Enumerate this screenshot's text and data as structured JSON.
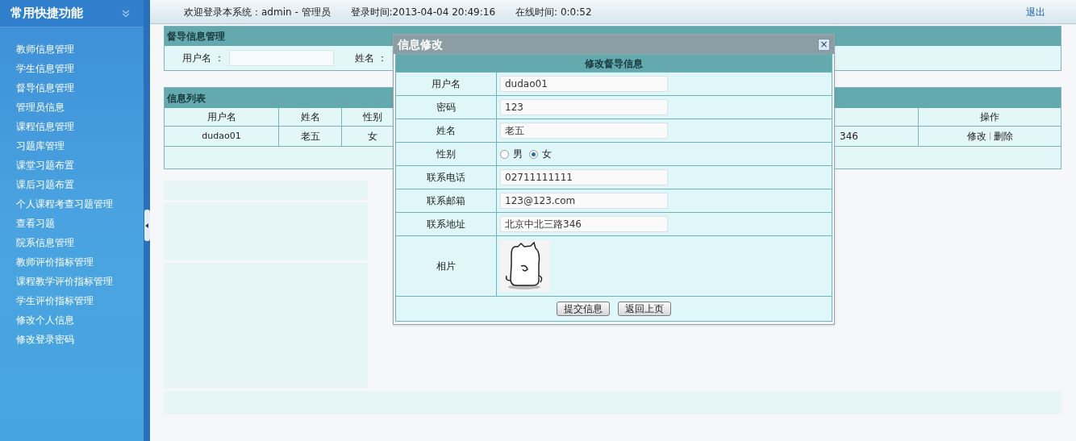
{
  "sidebar": {
    "title": "常用快捷功能",
    "items": [
      {
        "label": "教师信息管理"
      },
      {
        "label": "学生信息管理"
      },
      {
        "label": "督导信息管理"
      },
      {
        "label": "管理员信息"
      },
      {
        "label": "课程信息管理"
      },
      {
        "label": "习题库管理"
      },
      {
        "label": "课堂习题布置"
      },
      {
        "label": "课后习题布置"
      },
      {
        "label": "个人课程考查习题管理"
      },
      {
        "label": "查看习题"
      },
      {
        "label": "院系信息管理"
      },
      {
        "label": "教师评价指标管理"
      },
      {
        "label": "课程教学评价指标管理"
      },
      {
        "label": "学生评价指标管理"
      },
      {
        "label": "修改个人信息"
      },
      {
        "label": "修改登录密码"
      }
    ]
  },
  "header": {
    "welcome": "欢迎登录本系统：admin - 管理员",
    "login_time": "登录时间:2013-04-04 20:49:16",
    "online_time": "在线时间: 0:0:52",
    "logout": "退出"
  },
  "search_panel": {
    "title": "督导信息管理",
    "fields": [
      {
        "label": "用户名 ："
      },
      {
        "label": "姓名 ："
      }
    ]
  },
  "list_panel": {
    "title": "信息列表",
    "columns": [
      "用户名",
      "姓名",
      "性别",
      "操作"
    ],
    "rows": [
      {
        "cells": [
          "dudao01",
          "老五",
          "女",
          "346"
        ],
        "actions": [
          "修改",
          "删除"
        ]
      }
    ]
  },
  "dialog": {
    "title": "信息修改",
    "close": "×",
    "heading": "修改督导信息",
    "fields": [
      {
        "label": "用户名",
        "kind": "text",
        "value": "dudao01"
      },
      {
        "label": "密码",
        "kind": "text",
        "value": "123"
      },
      {
        "label": "姓名",
        "kind": "text",
        "value": "老五"
      },
      {
        "label": "性别",
        "kind": "radio",
        "options": [
          {
            "label": "男",
            "selected": false
          },
          {
            "label": "女",
            "selected": true
          }
        ]
      },
      {
        "label": "联系电话",
        "kind": "text",
        "value": "02711111111"
      },
      {
        "label": "联系邮箱",
        "kind": "text",
        "value": "123@123.com"
      },
      {
        "label": "联系地址",
        "kind": "text",
        "value": "北京中北三路346"
      },
      {
        "label": "相片"
      }
    ],
    "buttons": [
      "提交信息",
      "返回上页"
    ]
  }
}
